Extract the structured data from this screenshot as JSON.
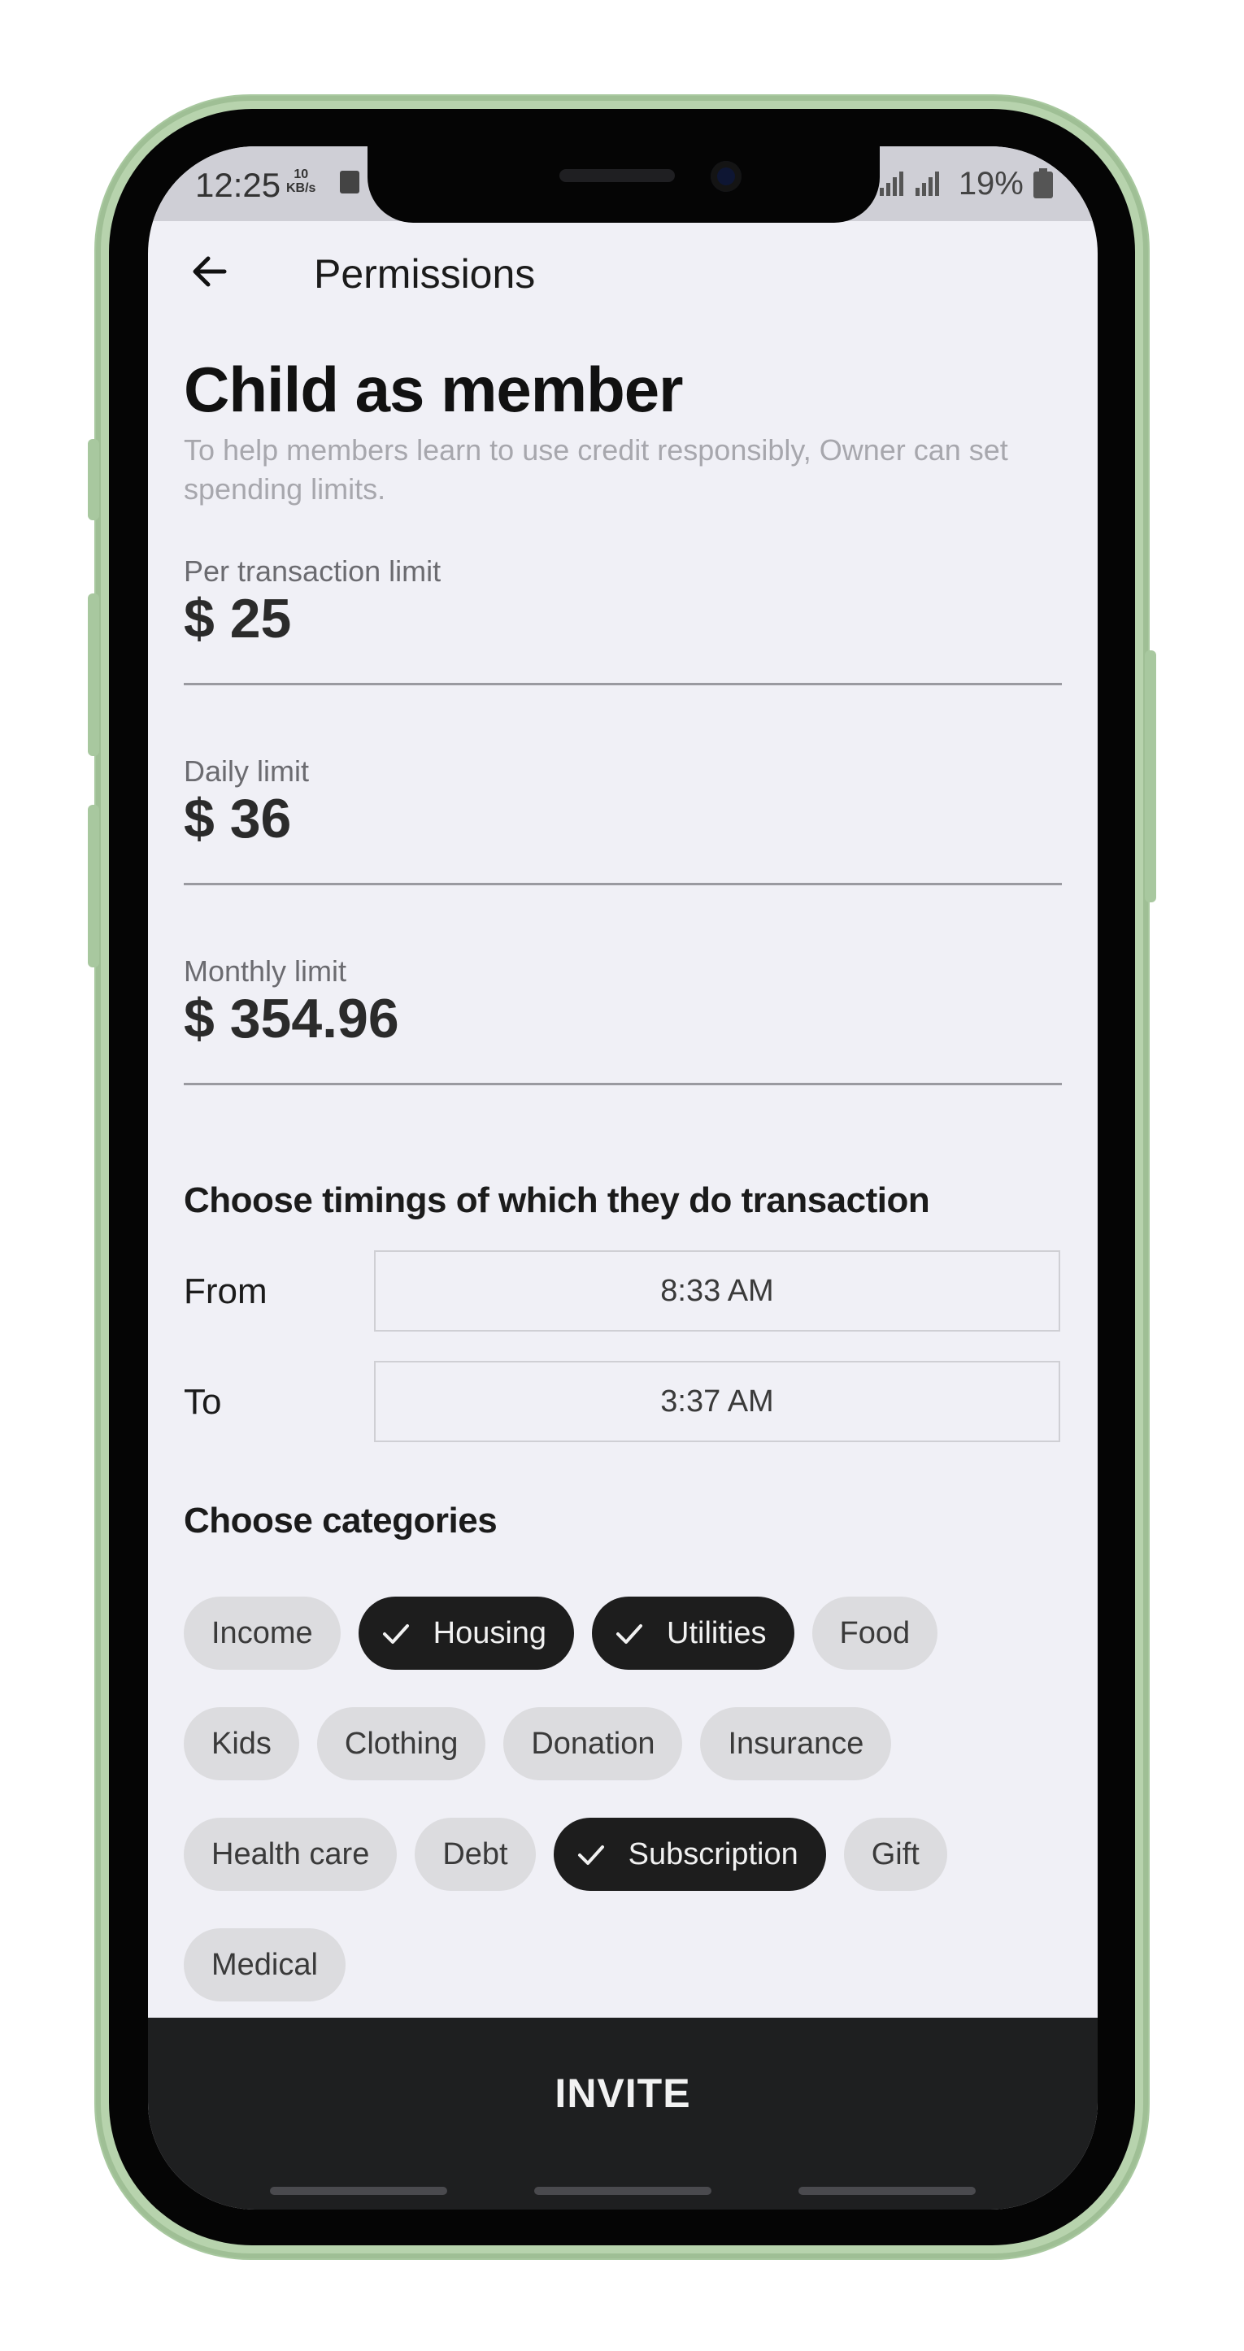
{
  "status_bar": {
    "time": "12:25",
    "speed_value": "10",
    "speed_unit": "KB/s",
    "battery": "19%"
  },
  "app_bar": {
    "back_icon": "arrow-left-icon",
    "title": "Permissions"
  },
  "header": {
    "title": "Child as member",
    "subtitle": "To help members learn to use credit responsibly, Owner can set spending limits."
  },
  "limits": [
    {
      "label": "Per transaction limit",
      "value": "$ 25"
    },
    {
      "label": "Daily limit",
      "value": "$ 36"
    },
    {
      "label": "Monthly limit",
      "value": "$ 354.96"
    }
  ],
  "timings": {
    "title": "Choose timings of which they do transaction",
    "from_label": "From",
    "from_value": "8:33 AM",
    "to_label": "To",
    "to_value": "3:37 AM"
  },
  "categories": {
    "title": "Choose categories",
    "chips": [
      {
        "label": "Income",
        "selected": false
      },
      {
        "label": "Housing",
        "selected": true
      },
      {
        "label": "Utilities",
        "selected": true
      },
      {
        "label": "Food",
        "selected": false
      },
      {
        "label": "Kids",
        "selected": false
      },
      {
        "label": "Clothing",
        "selected": false
      },
      {
        "label": "Donation",
        "selected": false
      },
      {
        "label": "Insurance",
        "selected": false
      },
      {
        "label": "Health care",
        "selected": false
      },
      {
        "label": "Debt",
        "selected": false
      },
      {
        "label": "Subscription",
        "selected": true
      },
      {
        "label": "Gift",
        "selected": false
      },
      {
        "label": "Medical",
        "selected": false
      }
    ]
  },
  "footer": {
    "invite_label": "INVITE"
  },
  "colors": {
    "background": "#f0f0f6",
    "chip_selected": "#1d1d1d",
    "chip_default": "#dcdcdf",
    "invite_bar": "#1e1f20",
    "phone_frame": "#b7d3ad"
  }
}
